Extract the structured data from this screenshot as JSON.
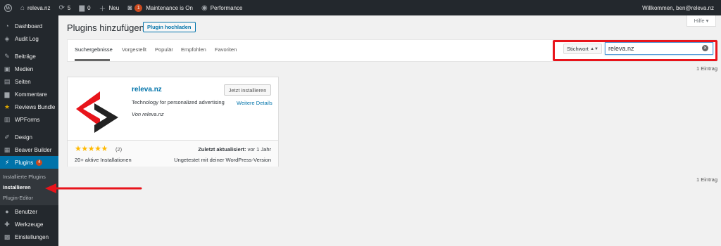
{
  "colors": {
    "adminbar": "#23282d",
    "accent": "#0073aa",
    "badge": "#ca4a1f",
    "annotation": "#e8141b",
    "star": "#ffb900"
  },
  "adminbar": {
    "wp_icon": "wordpress-icon",
    "site_name": "releva.nz",
    "updates_count": "5",
    "comments_count": "0",
    "new_label": "Neu",
    "plugin_badge": "1",
    "maintenance_label": "Maintenance is On",
    "performance_label": "Performance",
    "greeting": "Willkommen, ben@releva.nz"
  },
  "sidebar": {
    "items": [
      {
        "label": "Dashboard",
        "icon": "dashboard-icon"
      },
      {
        "label": "Audit Log",
        "icon": "audit-log-icon"
      },
      {
        "label": "Beiträge",
        "icon": "pin-icon"
      },
      {
        "label": "Medien",
        "icon": "media-icon"
      },
      {
        "label": "Seiten",
        "icon": "page-icon"
      },
      {
        "label": "Kommentare",
        "icon": "comment-icon"
      },
      {
        "label": "Reviews Bundle",
        "icon": "star-icon"
      },
      {
        "label": "WPForms",
        "icon": "forms-icon"
      },
      {
        "label": "Design",
        "icon": "brush-icon"
      },
      {
        "label": "Beaver Builder",
        "icon": "builder-icon"
      },
      {
        "label": "Plugins",
        "icon": "plugin-icon",
        "badge": "4"
      },
      {
        "label": "Benutzer",
        "icon": "user-icon"
      },
      {
        "label": "Werkzeuge",
        "icon": "wrench-icon"
      },
      {
        "label": "Einstellungen",
        "icon": "settings-icon"
      }
    ],
    "submenu": [
      "Installierte Plugins",
      "Installieren",
      "Plugin-Editor"
    ]
  },
  "help_tab": "Hilfe ▾",
  "page": {
    "title": "Plugins hinzufügen",
    "upload_button": "Plugin hochladen"
  },
  "filter": {
    "tabs": [
      "Suchergebnisse",
      "Vorgestellt",
      "Populär",
      "Empfohlen",
      "Favoriten"
    ],
    "search_type": "Stichwort",
    "search_value": "releva.nz"
  },
  "results_count": "1 Eintrag",
  "plugin": {
    "name": "releva.nz",
    "install_label": "Jetzt installieren",
    "description": "Technology for personalized advertising",
    "details_label": "Weitere Details",
    "author": "Von releva.nz",
    "rating": 5,
    "rating_stars": "★★★★★",
    "rating_count": "(2)",
    "last_updated_label": "Zuletzt aktualisiert:",
    "last_updated_value": "vor 1 Jahr",
    "active_installs": "20+ aktive Installationen",
    "compatibility": "Ungetestet mit deiner WordPress-Version"
  }
}
